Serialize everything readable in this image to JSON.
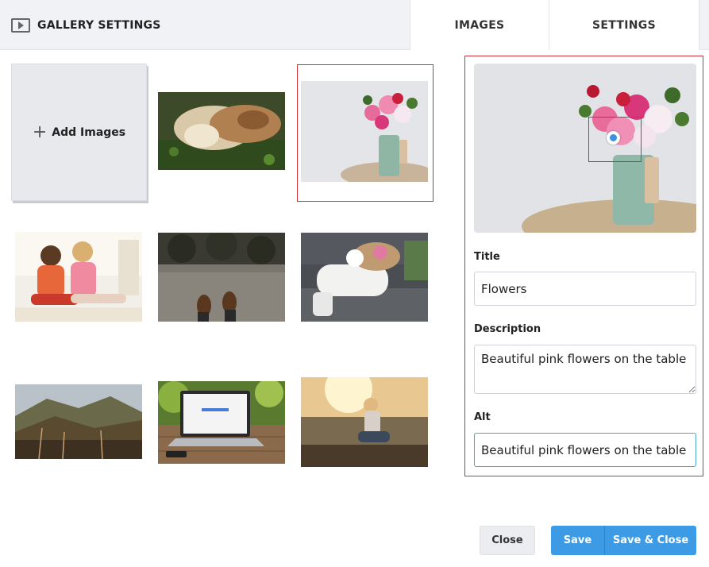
{
  "header": {
    "title": "GALLERY SETTINGS",
    "tabs": [
      {
        "label": "IMAGES"
      },
      {
        "label": "SETTINGS"
      }
    ]
  },
  "gallery": {
    "add_label": "Add Images",
    "images": [
      {
        "subject": "cat and dog lying in grass"
      },
      {
        "subject": "flowers in vase",
        "selected": true
      },
      {
        "subject": "two women laughing"
      },
      {
        "subject": "feet on pavement"
      },
      {
        "subject": "person with coffee on steps"
      },
      {
        "subject": "hills landscape"
      },
      {
        "subject": "laptop on table"
      },
      {
        "subject": "woman in sunlight by lake"
      }
    ]
  },
  "editor": {
    "title_label": "Title",
    "title_value": "Flowers",
    "description_label": "Description",
    "description_value": "Beautiful pink flowers on the table",
    "alt_label": "Alt",
    "alt_value": "Beautiful pink flowers on the table"
  },
  "footer": {
    "close_label": "Close",
    "save_label": "Save",
    "save_close_label": "Save & Close"
  },
  "colors": {
    "accent": "#3d9be5",
    "selection_border": "#d0303a",
    "focus_dot": "#3d8fe0"
  }
}
